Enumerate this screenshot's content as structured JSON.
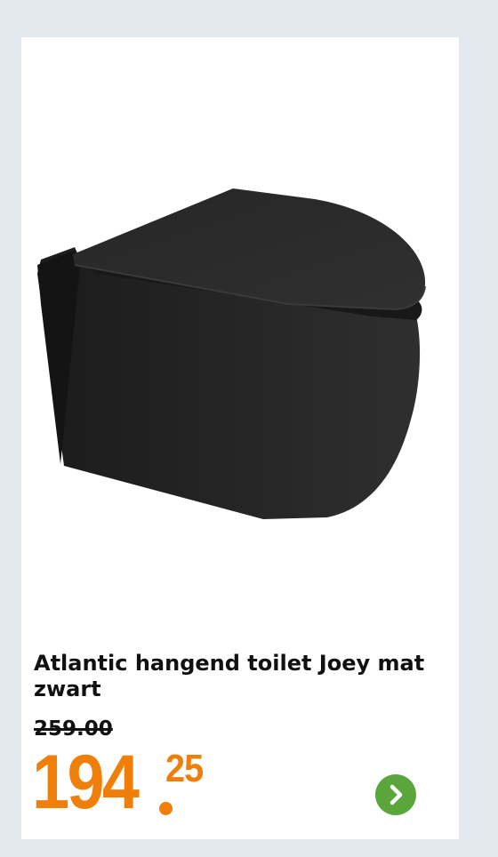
{
  "product": {
    "title": "Atlantic hangend toilet Joey mat zwart",
    "image_icon": "wall-hung-toilet-image",
    "old_price": "259.00",
    "price_main": "194",
    "price_cents": "25"
  },
  "colors": {
    "background": "#e3e7ee",
    "card": "#ffffff",
    "price": "#f07f0a",
    "button": "#5aa63d",
    "product": "#1f1f1f"
  },
  "navigation": {
    "next_icon": "chevron-right-icon"
  }
}
